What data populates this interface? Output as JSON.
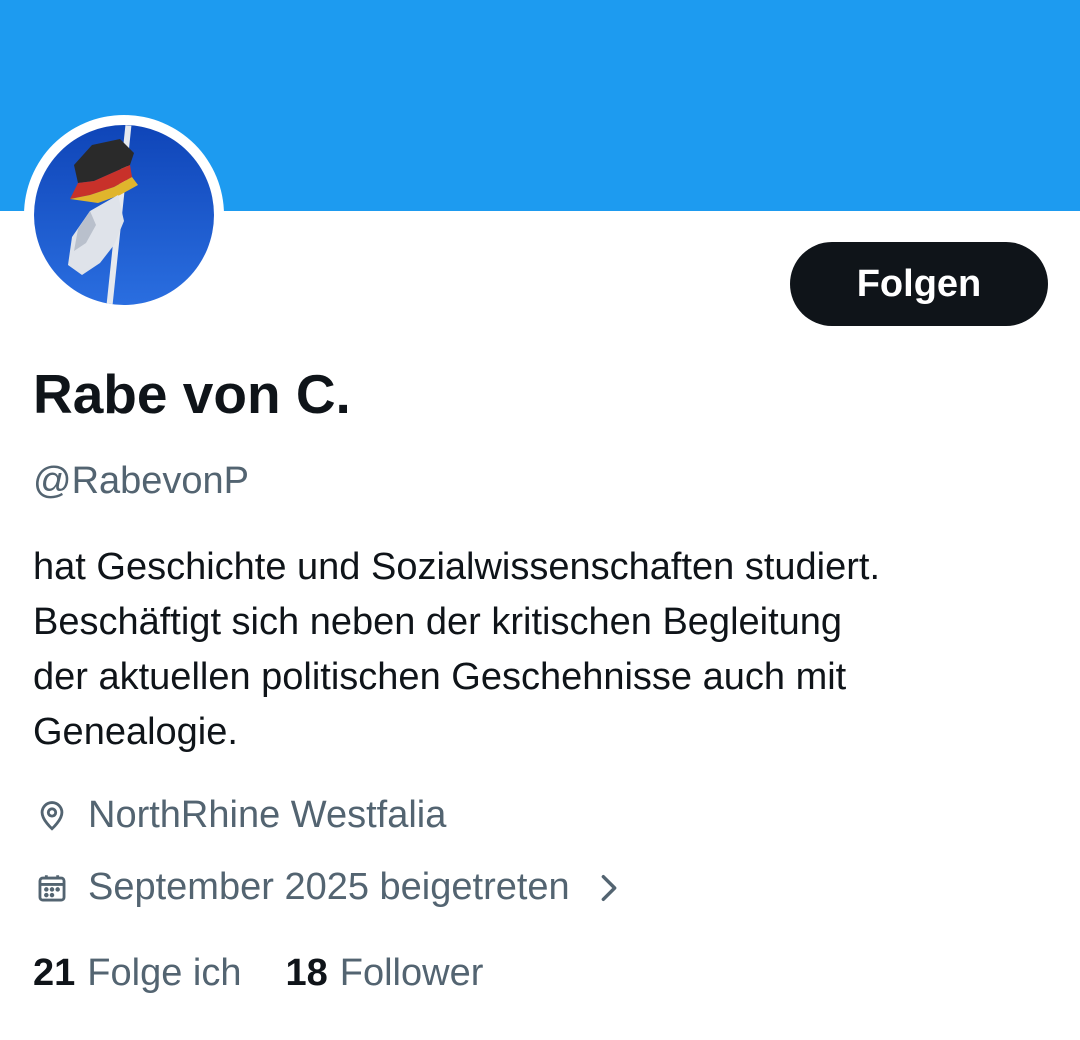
{
  "colors": {
    "banner": "#1d9bf0",
    "primary_text": "#0f1419",
    "secondary_text": "#536471",
    "button_bg": "#0f1419",
    "button_text": "#ffffff"
  },
  "profile": {
    "display_name": "Rabe von C.",
    "handle": "@RabevonP",
    "follow_button_label": "Folgen",
    "bio_lines": [
      "hat Geschichte und Sozialwissenschaften studiert.",
      "Beschäftigt sich neben der kritischen Begleitung",
      "der aktuellen politischen Geschehnisse auch mit",
      "Genealogie."
    ],
    "location": "NorthRhine Westfalia",
    "joined": "September 2025 beigetreten"
  },
  "icons": {
    "location": "location-pin-icon",
    "joined": "calendar-icon",
    "more": "chevron-right-icon"
  },
  "stats": {
    "following_count": "21",
    "following_label": "Folge ich",
    "followers_count": "18",
    "followers_label": "Follower"
  }
}
